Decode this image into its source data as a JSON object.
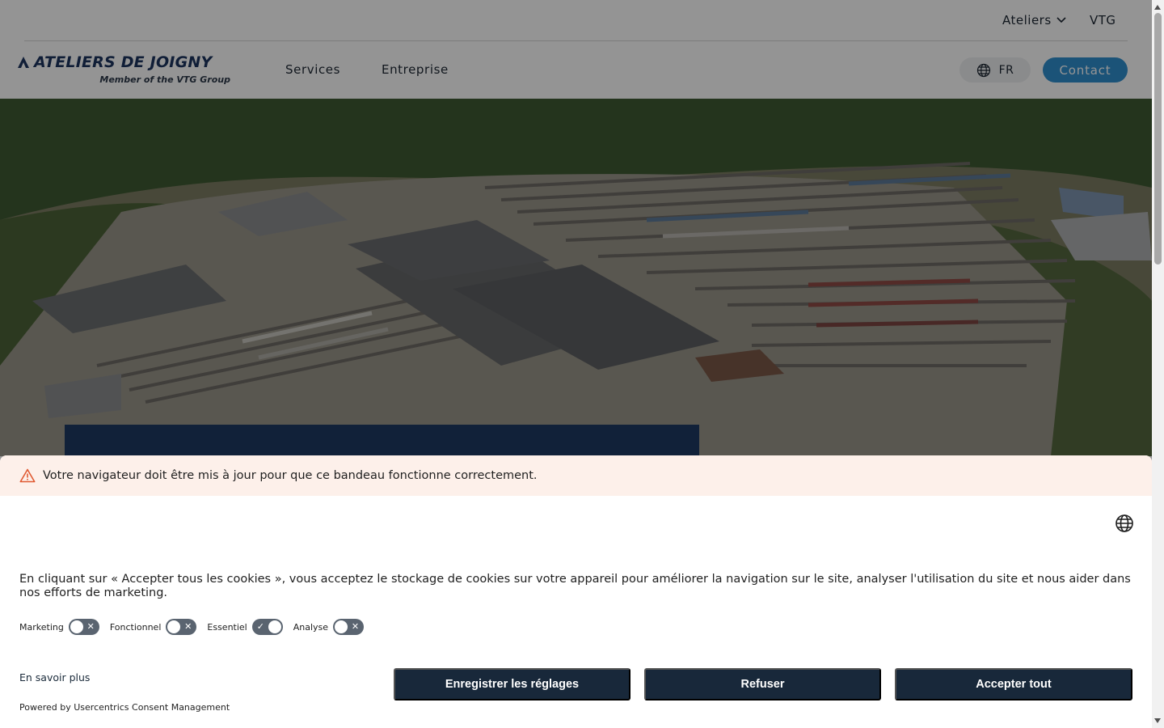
{
  "header": {
    "top_links": [
      "Ateliers",
      "VTG"
    ],
    "logo_title": "ATELIERS DE JOIGNY",
    "logo_subtitle": "Member of the VTG Group",
    "nav": [
      "Services",
      "Entreprise"
    ],
    "language": "FR",
    "contact_label": "Contact",
    "icons": {
      "dropdown": "chevron-down-icon",
      "language": "globe-icon",
      "logo": "vtg-logo-icon"
    }
  },
  "hero": {
    "image": "aerial-rail-workshop-photo",
    "card_color": "#1e3a63"
  },
  "consent": {
    "warning_text": "Votre navigateur doit être mis à jour pour que ce bandeau fonctionne correctement.",
    "description": "En cliquant sur « Accepter tous les cookies », vous acceptez le stockage de cookies sur votre appareil pour améliorer la navigation sur le site, analyser l'utilisation du site et nous aider dans nos efforts de marketing.",
    "toggles": [
      {
        "label": "Marketing",
        "enabled": false
      },
      {
        "label": "Fonctionnel",
        "enabled": false
      },
      {
        "label": "Essentiel",
        "enabled": true
      },
      {
        "label": "Analyse",
        "enabled": false
      }
    ],
    "learn_more": "En savoir plus",
    "powered_by": "Powered by Usercentrics Consent Management",
    "buttons": {
      "save": "Enregistrer les réglages",
      "deny": "Refuser",
      "accept": "Accepter tout"
    },
    "colors": {
      "button_bg": "#18283a",
      "warning_bg": "#fdf0ea",
      "warning_icon": "#e05a32"
    }
  }
}
